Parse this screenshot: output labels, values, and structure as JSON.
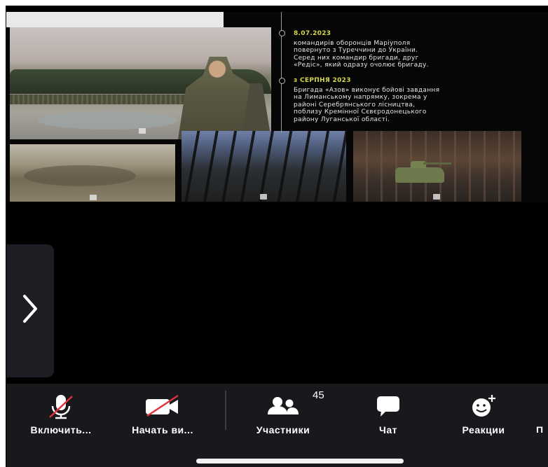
{
  "slide": {
    "timeline": [
      {
        "date": "8.07.2023",
        "lines": [
          "командирів оборонців Маріуполя",
          "повернуто з Туреччини до України.",
          "Серед них командир бригади, друг",
          "«Редіс», який одразу очолює бригаду."
        ]
      },
      {
        "date": "з СЕРПНЯ 2023",
        "lines": [
          "Бригада «Азов» виконує бойові завдання",
          "на Лиманському напрямку, зокрема у",
          "районі Серебрянського лісництва,",
          "поблизу Кремінної Сєвєродонецького",
          "району Луганської області."
        ]
      }
    ]
  },
  "side_panel": {
    "icon": "chevron-right-icon"
  },
  "toolbar": {
    "items": [
      {
        "label": "Включить...",
        "icon": "microphone-muted-icon"
      },
      {
        "label": "Начать ви...",
        "icon": "video-off-icon"
      },
      {
        "label": "Участники",
        "icon": "participants-icon",
        "badge": "45"
      },
      {
        "label": "Чат",
        "icon": "chat-icon"
      },
      {
        "label": "Реакции",
        "icon": "reaction-icon"
      },
      {
        "label": "П",
        "icon": ""
      }
    ]
  },
  "colors": {
    "accent_date": "#d6d84a",
    "toolbar_bg": "#17191c",
    "mute_red": "#e0323b"
  }
}
